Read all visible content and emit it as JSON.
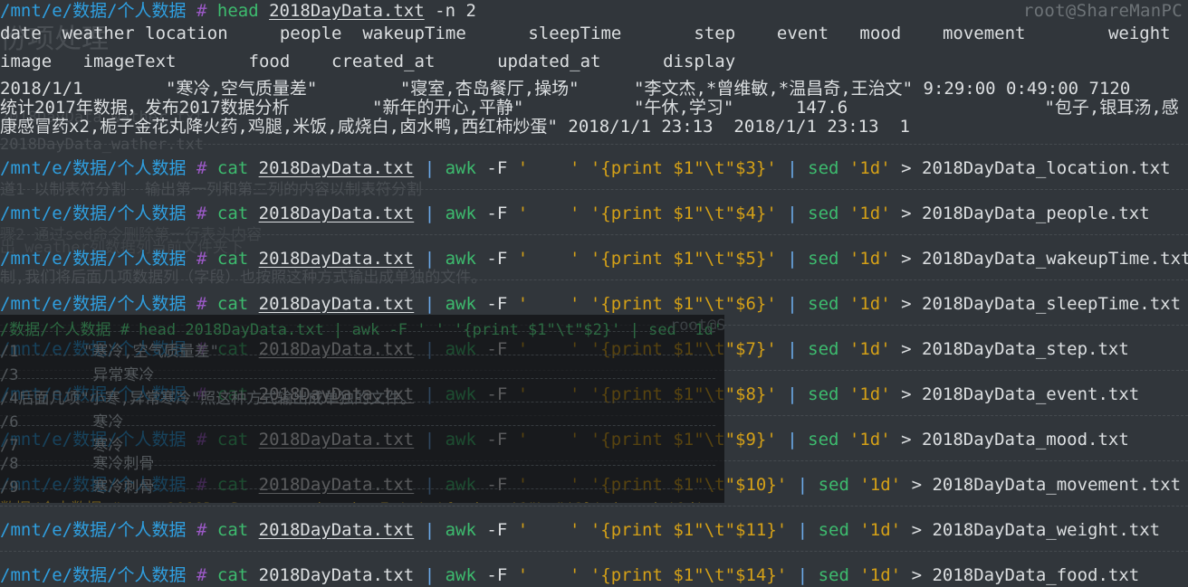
{
  "terminal": {
    "host_label": "root@ShareManPC",
    "prompt_path": "/mnt/e/数据/个人数据",
    "prompt_symbol": "#",
    "datafile": "2018DayData.txt"
  },
  "watermark": {
    "big_text": "份项处理",
    "small_text": "2018DayData_wather.txt",
    "note1": "道1 以制表符分割  输出第一列和第二列的内容以制表符分割",
    "note2": "骤2 通过sed命令删除第一行表头内容",
    "note3": "出 weather列数据列当前文件夹下",
    "note4": "制,我们将后面几项数据列（字段）也按照这种方式输出成单独的文件。"
  },
  "head_command": {
    "cmd": "head",
    "file": "2018DayData.txt",
    "args": "-n 2"
  },
  "head_output": {
    "header_line1": "date  weather location     people  wakeupTime      sleepTime       step    event   mood    movement        weight",
    "header_line2": "image   imageText       food    created_at      updated_at      display",
    "row1_part1": "2018/1/1        \"寒冷,空气质量差\"        \"寝室,杏岛餐厅,操场\"",
    "row1_part2": "\"李文杰,*曾维敏,*温昌奇,王治文\" 9:29:00 0:49:00 7120",
    "row2_part1": "统计2017年数据，发布2017数据分析        \"新年的开心,平静\"",
    "row2_part2": "\"午休,学习\"      147.6                   \"包子,银耳汤,感",
    "row3": "康感冒药x2,栀子金花丸降火药,鸡腿,米饭,咸烧白,卤水鸭,西红柿炒蛋\" 2018/1/1 23:13  2018/1/1 23:13  1"
  },
  "commands": [
    {
      "cmd": "cat",
      "file": "2018DayData.txt",
      "pipe": "|",
      "awk": "awk",
      "flag": "-F",
      "fs": "'\t'",
      "program": "'{print $1\"\\t\"$3}'",
      "field": "$3",
      "sed": "sed",
      "sed_arg": "'1d'",
      "redirect": ">",
      "output": "2018DayData_location.txt",
      "underlined": true
    },
    {
      "cmd": "cat",
      "file": "2018DayData.txt",
      "pipe": "|",
      "awk": "awk",
      "flag": "-F",
      "fs": "'\t'",
      "program": "'{print $1\"\\t\"$4}'",
      "field": "$4",
      "sed": "sed",
      "sed_arg": "'1d'",
      "redirect": ">",
      "output": "2018DayData_people.txt",
      "underlined": true
    },
    {
      "cmd": "cat",
      "file": "2018DayData.txt",
      "pipe": "|",
      "awk": "awk",
      "flag": "-F",
      "fs": "'\t'",
      "program": "'{print $1\"\\t\"$5}'",
      "field": "$5",
      "sed": "sed",
      "sed_arg": "'1d'",
      "redirect": ">",
      "output": "2018DayData_wakeupTime.txt",
      "underlined": true
    },
    {
      "cmd": "cat",
      "file": "2018DayData.txt",
      "pipe": "|",
      "awk": "awk",
      "flag": "-F",
      "fs": "'\t'",
      "program": "'{print $1\"\\t\"$6}'",
      "field": "$6",
      "sed": "sed",
      "sed_arg": "'1d'",
      "redirect": ">",
      "output": "2018DayData_sleepTime.txt",
      "underlined": true
    },
    {
      "cmd": "cat",
      "file": "2018DayData.txt",
      "pipe": "|",
      "awk": "awk",
      "flag": "-F",
      "fs": "'\t'",
      "program": "'{print $1\"\\t\"$7}'",
      "field": "$7",
      "sed": "sed",
      "sed_arg": "'1d'",
      "redirect": ">",
      "output": "2018DayData_step.txt",
      "underlined": true
    },
    {
      "cmd": "cat",
      "file": "2018DayData.txt",
      "pipe": "|",
      "awk": "awk",
      "flag": "-F",
      "fs": "'\t'",
      "program": "'{print $1\"\\t\"$8}'",
      "field": "$8",
      "sed": "sed",
      "sed_arg": "'1d'",
      "redirect": ">",
      "output": "2018DayData_event.txt",
      "underlined": true
    },
    {
      "cmd": "cat",
      "file": "2018DayData.txt",
      "pipe": "|",
      "awk": "awk",
      "flag": "-F",
      "fs": "'\t'",
      "program": "'{print $1\"\\t\"$9}'",
      "field": "$9",
      "sed": "sed",
      "sed_arg": "'1d'",
      "redirect": ">",
      "output": "2018DayData_mood.txt",
      "underlined": true
    },
    {
      "cmd": "cat",
      "file": "2018DayData.txt",
      "pipe": "|",
      "awk": "awk",
      "flag": "-F",
      "fs": "'\t'",
      "program": "'{print $1\"\\t\"$10}'",
      "field": "$10",
      "sed": "sed",
      "sed_arg": "'1d'",
      "redirect": ">",
      "output": "2018DayData_movement.txt",
      "underlined": true
    },
    {
      "cmd": "cat",
      "file": "2018DayData.txt",
      "pipe": "|",
      "awk": "awk",
      "flag": "-F",
      "fs": "'\t'",
      "program": "'{print $1\"\\t\"$11}'",
      "field": "$11",
      "sed": "sed",
      "sed_arg": "'1d'",
      "redirect": ">",
      "output": "2018DayData_weight.txt",
      "underlined": true
    },
    {
      "cmd": "cat",
      "file": "2018DayData.txt",
      "pipe": "|",
      "awk": "awk",
      "flag": "-F",
      "fs": "'\t'",
      "program": "'{print $1\"\\t\"$14}'",
      "field": "$14",
      "sed": "sed",
      "sed_arg": "'1d'",
      "redirect": ">",
      "output": "2018DayData_food.txt",
      "underlined": false
    }
  ],
  "ghost_panel": {
    "host": "root@Share",
    "line1": "/数据/个人数据 # head 2018DayData.txt | awk -F ' ' '{print $1\"\\t\"$2}' | sed '1d'",
    "line2": "/1       \"寒冷,空气质量差\"",
    "line3": "/3        异常寒冷",
    "line4": "/4后面几项\"小寒,异常寒冷\"照这种方式输出成单独的文件。",
    "line5": "/6        寒冷",
    "line6": "/7        寒冷",
    "line7": "/8        寒冷刺骨",
    "line8": "/9        寒冷刺骨",
    "line9": "数据/个人数据 # cat 2018DayData.txt | awk -F ' ' '{print $1\"\\t\"$2}' | sed '1d' > 2018DayData_weather.txt"
  },
  "colors": {
    "background": "#31363b",
    "path": "#2f9fe0",
    "hash": "#9b59c6",
    "command": "#3dbb6e",
    "string": "#d4a017",
    "pipe": "#6ca9e8",
    "text": "#dcdfe1",
    "dim": "#6d7377"
  }
}
